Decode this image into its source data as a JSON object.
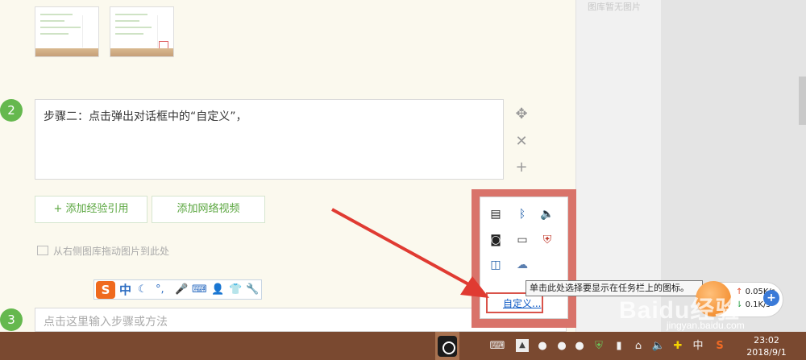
{
  "right_panel": {
    "empty_note": "图库暂无图片"
  },
  "steps": [
    {
      "number": "2",
      "text": "步骤二：点击弹出对话框中的“自定义”，"
    },
    {
      "number": "3",
      "placeholder": "点击这里输入步骤或方法"
    }
  ],
  "buttons": {
    "add_reference": "+ 添加经验引用",
    "add_video": "添加网络视频"
  },
  "drag_hint": "从右侧图库拖动图片到此处",
  "ime": {
    "logo": "S",
    "mode": "中"
  },
  "tray_popup": {
    "customize_link": "自定义..."
  },
  "tooltip": "单击此处选择要显示在任务栏上的图标。",
  "net_speed": {
    "up": "0.05K/s",
    "down": "0.1K/s"
  },
  "taskbar": {
    "lang": "中",
    "time": "23:02",
    "date": "2018/9/1"
  },
  "watermark": {
    "brand": "Baidu经验",
    "url": "jingyan.baidu.com"
  }
}
